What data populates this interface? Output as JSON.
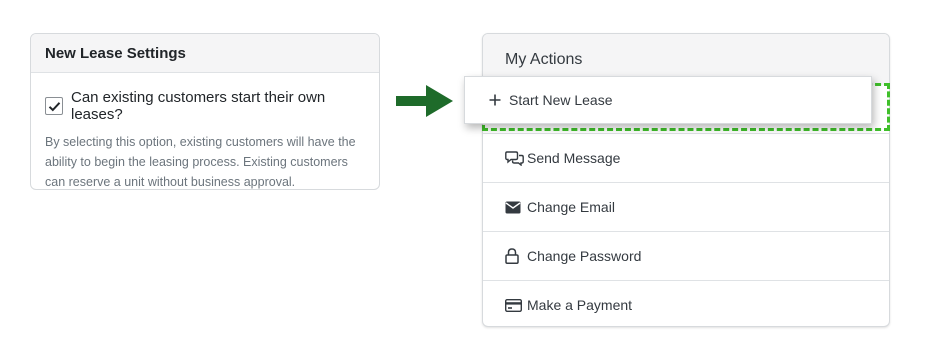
{
  "settings": {
    "title": "New Lease Settings",
    "checkbox_label": "Can existing customers start their own leases?",
    "checked": true,
    "help_text": "By selecting this option, existing customers will have the ability to begin the leasing process. Existing customers can reserve a unit without business approval."
  },
  "arrow": {
    "color": "#1e6b2a",
    "icon": "arrow-right-icon"
  },
  "actions": {
    "title": "My Actions",
    "highlight_color": "#3fbf2a",
    "highlighted_item": {
      "label": "Start New Lease",
      "icon": "plus-icon"
    },
    "items": [
      {
        "label": "Send Message",
        "icon": "chat-bubbles-icon"
      },
      {
        "label": "Change Email",
        "icon": "envelope-icon"
      },
      {
        "label": "Change Password",
        "icon": "lock-icon"
      },
      {
        "label": "Make a Payment",
        "icon": "credit-card-icon"
      }
    ]
  }
}
